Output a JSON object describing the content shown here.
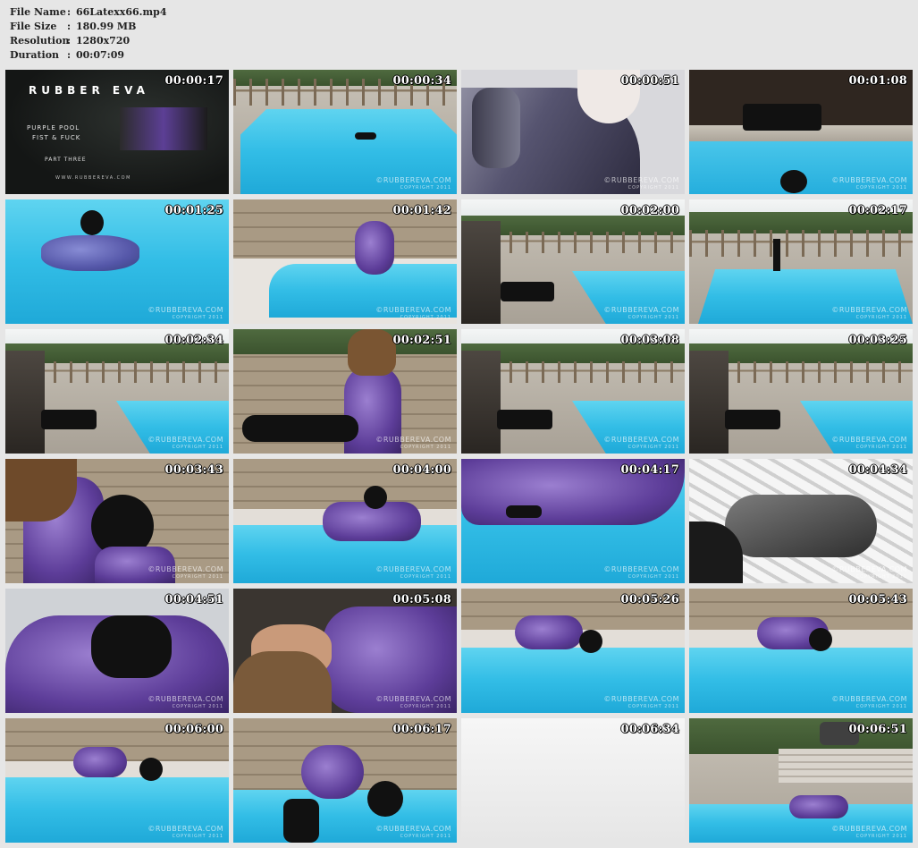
{
  "info": {
    "rows": [
      {
        "label": "File Name",
        "sep": ":",
        "value": "66Latexx66.mp4"
      },
      {
        "label": "File Size",
        "sep": ":",
        "value": "180.99 MB"
      },
      {
        "label": "Resolution",
        "sep": ":",
        "value": "1280x720"
      },
      {
        "label": "Duration",
        "sep": ":",
        "value": "00:07:09"
      }
    ]
  },
  "title_card": {
    "brand": "RUBBER EVA",
    "line1": "PURPLE POOL",
    "line2": "FIST & FUCK",
    "line3": "PART THREE",
    "url": "WWW.RUBBEREVA.COM"
  },
  "watermark": {
    "brand": "©RUBBEREVA.COM",
    "copyright": "COPYRIGHT 2011"
  },
  "thumbnails": [
    {
      "time": "00:00:17"
    },
    {
      "time": "00:00:34"
    },
    {
      "time": "00:00:51"
    },
    {
      "time": "00:01:08"
    },
    {
      "time": "00:01:25"
    },
    {
      "time": "00:01:42"
    },
    {
      "time": "00:02:00"
    },
    {
      "time": "00:02:17"
    },
    {
      "time": "00:02:34"
    },
    {
      "time": "00:02:51"
    },
    {
      "time": "00:03:08"
    },
    {
      "time": "00:03:25"
    },
    {
      "time": "00:03:43"
    },
    {
      "time": "00:04:00"
    },
    {
      "time": "00:04:17"
    },
    {
      "time": "00:04:34"
    },
    {
      "time": "00:04:51"
    },
    {
      "time": "00:05:08"
    },
    {
      "time": "00:05:26"
    },
    {
      "time": "00:05:43"
    },
    {
      "time": "00:06:00"
    },
    {
      "time": "00:06:17"
    },
    {
      "time": "00:06:34"
    },
    {
      "time": "00:06:51"
    }
  ]
}
